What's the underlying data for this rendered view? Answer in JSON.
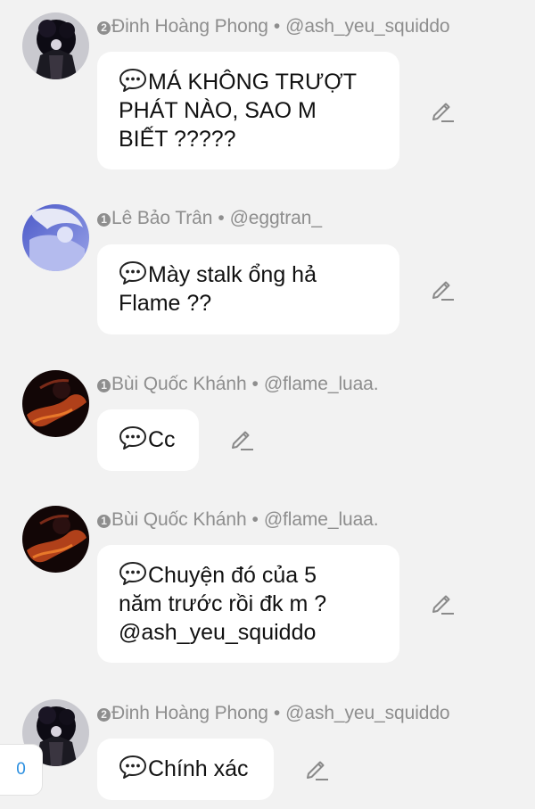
{
  "icons": {
    "chat": "speech-bubble-icon",
    "edit": "pencil-icon"
  },
  "colors": {
    "background": "#f2f2f2",
    "bubble": "#ffffff",
    "meta_text": "#8e8e8e",
    "counter": "#2b8fe0"
  },
  "messages": [
    {
      "rank": "2",
      "author": "Đinh Hoàng Phong",
      "sep": "•",
      "handle": "@ash_yeu_squiddo",
      "lines": [
        "MÁ KHÔNG TRƯỢT",
        "PHÁT NÀO, SAO M",
        "BIẾT ?????"
      ]
    },
    {
      "rank": "1",
      "author": "Lê Bảo Trân",
      "sep": "•",
      "handle": "@eggtran_",
      "lines": [
        "Mày stalk ổng hả",
        "Flame ??"
      ]
    },
    {
      "rank": "1",
      "author": "Bùi Quốc Khánh",
      "sep": "•",
      "handle": "@flame_luaa.",
      "lines": [
        "Cc"
      ]
    },
    {
      "rank": "1",
      "author": "Bùi Quốc Khánh",
      "sep": "•",
      "handle": "@flame_luaa.",
      "lines": [
        "Chuyện đó của 5",
        "năm trước rồi đk m ?",
        "@ash_yeu_squiddo"
      ]
    },
    {
      "rank": "2",
      "author": "Đinh Hoàng Phong",
      "sep": "•",
      "handle": "@ash_yeu_squiddo",
      "lines": [
        "Chính xác"
      ]
    }
  ],
  "counter": {
    "value": "0"
  }
}
